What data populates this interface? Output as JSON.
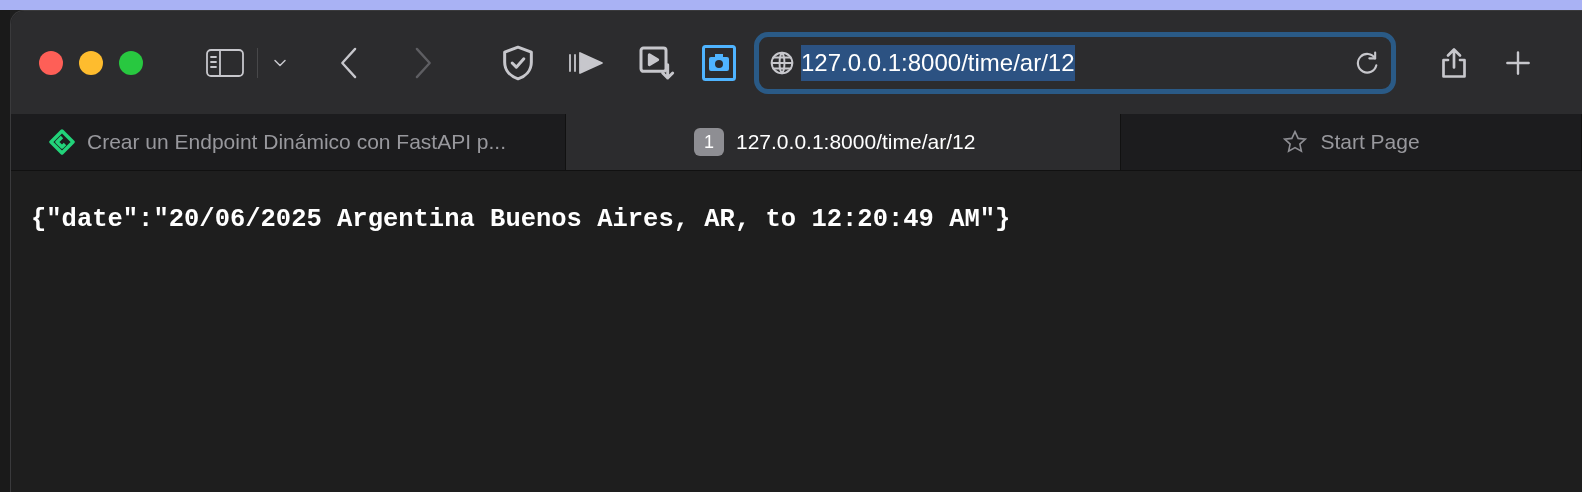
{
  "toolbar": {
    "address": {
      "value": "127.0.0.1:8000/time/ar/12",
      "selected": true
    }
  },
  "tabs": [
    {
      "kind": "site",
      "label": "Crear un Endpoint Dinámico con FastAPI p...",
      "selected": false
    },
    {
      "kind": "numbered",
      "badge": "1",
      "label": "127.0.0.1:8000/time/ar/12",
      "selected": true
    },
    {
      "kind": "start",
      "label": "Start Page",
      "selected": false
    }
  ],
  "content": {
    "text": "{\"date\":\"20/06/2025 Argentina Buenos Aires, AR, to 12:20:49 AM\"}"
  }
}
